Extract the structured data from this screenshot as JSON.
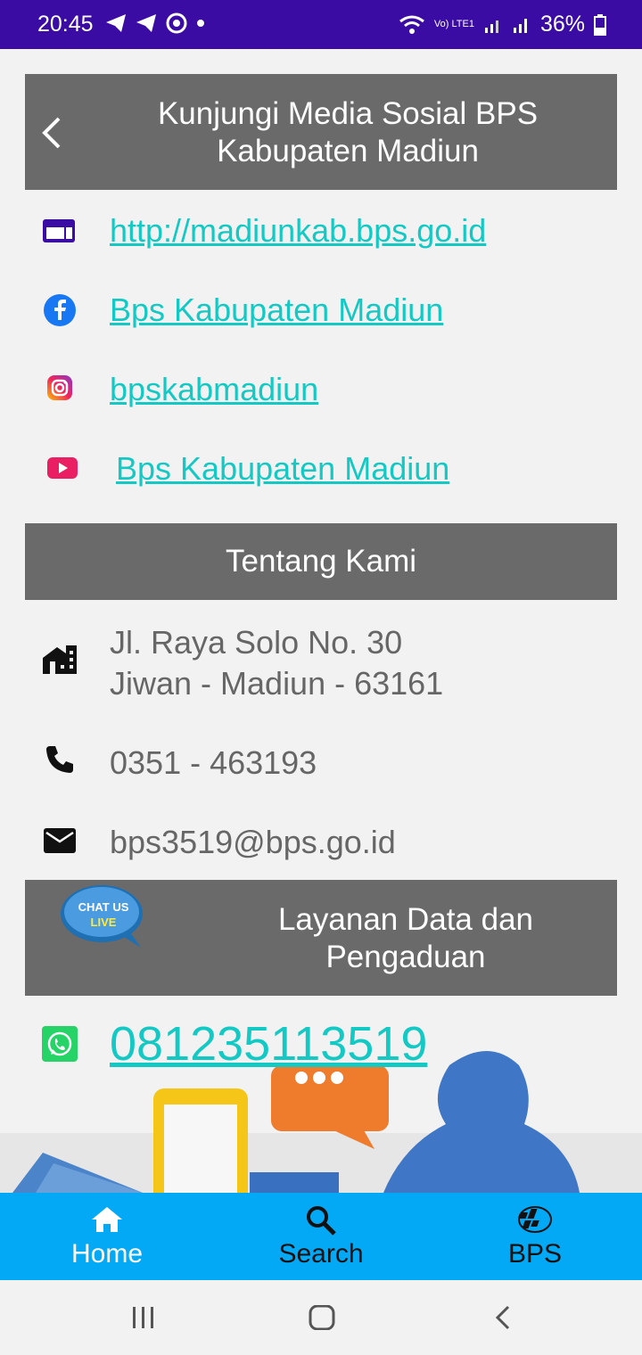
{
  "status_bar": {
    "time": "20:45",
    "battery": "36%",
    "network": "Vo) LTE1"
  },
  "section_social": {
    "title": "Kunjungi Media Sosial BPS Kabupaten Madiun",
    "items": [
      {
        "icon": "web-icon",
        "text": "http://madiunkab.bps.go.id"
      },
      {
        "icon": "facebook-icon",
        "text": "Bps Kabupaten Madiun"
      },
      {
        "icon": "instagram-icon",
        "text": "bpskabmadiun"
      },
      {
        "icon": "youtube-icon",
        "text": "Bps Kabupaten Madiun"
      }
    ]
  },
  "section_about": {
    "title": "Tentang Kami",
    "address_line1": "Jl. Raya Solo No. 30",
    "address_line2": "Jiwan - Madiun - 63161",
    "phone": "0351 - 463193",
    "email": "bps3519@bps.go.id"
  },
  "section_service": {
    "title": "Layanan Data dan Pengaduan",
    "chat_badge_top": "CHAT US",
    "chat_badge_bottom": "LIVE",
    "whatsapp": "081235113519"
  },
  "bottom_nav": [
    {
      "label": "Home",
      "icon": "home-icon"
    },
    {
      "label": "Search",
      "icon": "search-icon"
    },
    {
      "label": "BPS",
      "icon": "bps-logo-icon"
    }
  ],
  "colors": {
    "accent": "#03a9f4",
    "link": "#14c9c3",
    "header": "#6a6a6a",
    "status": "#3a0ca3"
  }
}
